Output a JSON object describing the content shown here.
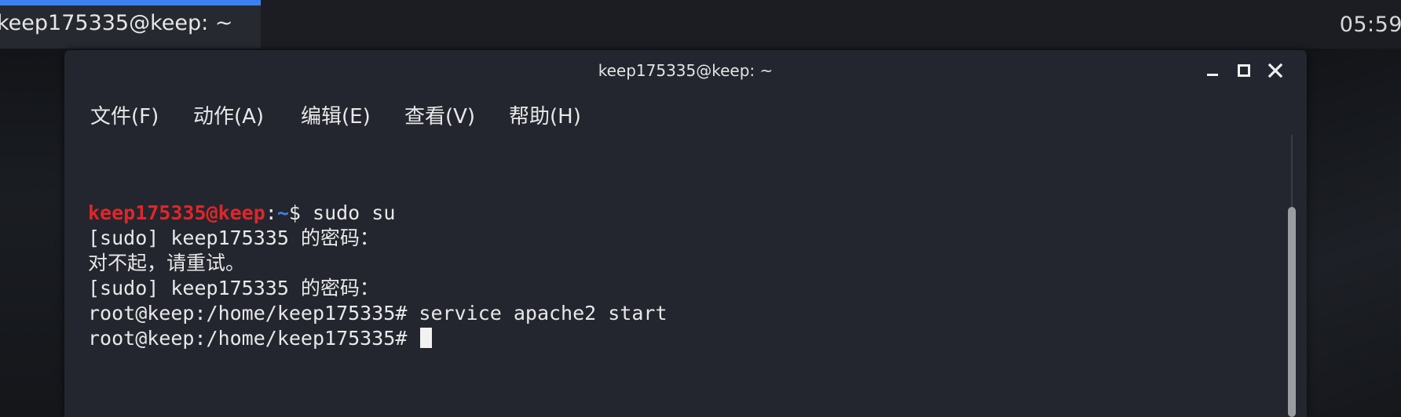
{
  "panel": {
    "taskbar_title": "keep175335@keep: ~",
    "clock": "05:59",
    "accent": "#3b82f0"
  },
  "window": {
    "title": "keep175335@keep: ~",
    "controls": [
      "minimize-icon",
      "maximize-icon",
      "close-icon"
    ]
  },
  "menubar": {
    "items": [
      {
        "label": "文件(F)"
      },
      {
        "label": "动作(A)"
      },
      {
        "label": "编辑(E)"
      },
      {
        "label": "查看(V)"
      },
      {
        "label": "帮助(H)"
      }
    ]
  },
  "terminal": {
    "prompt_user": "keep175335@keep",
    "prompt_sep": ":",
    "prompt_path": "~",
    "prompt_end": "$ ",
    "cmd1": "sudo su",
    "line2": "[sudo] keep175335 的密码：",
    "line3": "对不起，请重试。",
    "line4": "[sudo] keep175335 的密码：",
    "line5": "root@keep:/home/keep175335# service apache2 start",
    "line6": "root@keep:/home/keep175335# ",
    "colors": {
      "user": "#e0262a",
      "path": "#3b82f0",
      "text": "#e8e8e8",
      "background": "#23262e"
    }
  }
}
